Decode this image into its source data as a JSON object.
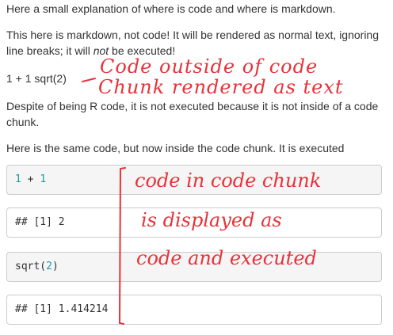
{
  "paragraphs": {
    "intro": "Here a small explanation of where is code and where is markdown.",
    "markdown_before": "This here is markdown, not code! It will be rendered as normal text, ignoring line breaks; it will ",
    "markdown_emph": "not",
    "markdown_after": " be executed!",
    "inline_code": "1 + 1 sqrt(2)",
    "despite": "Despite of being R code, it is not executed because it is not inside of a code chunk.",
    "same_code": "Here is the same code, but now inside the code chunk. It is executed"
  },
  "chunks": {
    "code1_a": "1",
    "code1_op": " + ",
    "code1_b": "1",
    "output1": "## [1] 2",
    "code2_fn": "sqrt(",
    "code2_arg": "2",
    "code2_close": ")",
    "output2": "## [1] 1.414214"
  },
  "annotations": {
    "outside_line1": "Code outside of code",
    "outside_line2": "Chunk rendered as text",
    "inside_line1": "code in code chunk",
    "inside_line2": "is displayed as",
    "inside_line3": "code and executed"
  },
  "colors": {
    "annotation": "#e8323a",
    "number": "#1c9aa5"
  }
}
